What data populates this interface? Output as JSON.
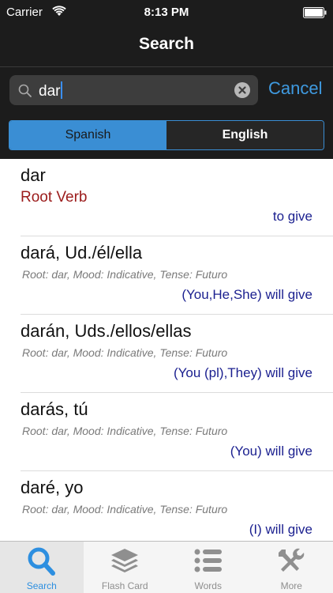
{
  "status": {
    "carrier": "Carrier",
    "time": "8:13 PM"
  },
  "nav": {
    "title": "Search"
  },
  "search": {
    "value": "dar",
    "cancel_label": "Cancel"
  },
  "segments": [
    {
      "label": "Spanish",
      "selected": true
    },
    {
      "label": "English",
      "selected": false
    }
  ],
  "results": [
    {
      "word": "dar",
      "subtitle": "Root Verb",
      "translation": "to give"
    },
    {
      "word": "dará, Ud./él/ella",
      "detail": "Root: dar, Mood: Indicative, Tense: Futuro",
      "translation": "(You,He,She) will give"
    },
    {
      "word": "darán, Uds./ellos/ellas",
      "detail": "Root: dar, Mood: Indicative, Tense: Futuro",
      "translation": "(You (pl),They) will give"
    },
    {
      "word": "darás, tú",
      "detail": "Root: dar, Mood: Indicative, Tense: Futuro",
      "translation": "(You) will give"
    },
    {
      "word": "daré, yo",
      "detail": "Root: dar, Mood: Indicative, Tense: Futuro",
      "translation": "(I) will give"
    }
  ],
  "tabs": [
    {
      "label": "Search",
      "icon": "search-icon",
      "selected": true
    },
    {
      "label": "Flash Card",
      "icon": "stack-icon",
      "selected": false
    },
    {
      "label": "Words",
      "icon": "list-icon",
      "selected": false
    },
    {
      "label": "More",
      "icon": "tools-icon",
      "selected": false
    }
  ],
  "colors": {
    "accent": "#3a8ed4",
    "root_verb": "#9b1b1b",
    "translation": "#1a1f8f"
  }
}
